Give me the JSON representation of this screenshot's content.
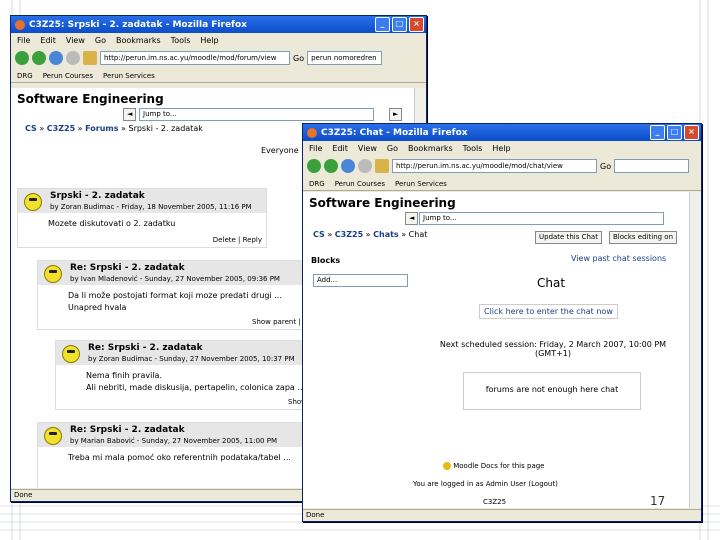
{
  "back_window": {
    "title": "C3Z25: Srpski - 2. zadatak - Mozilla Firefox",
    "menu": [
      "File",
      "Edit",
      "View",
      "Go",
      "Bookmarks",
      "Tools",
      "Help"
    ],
    "url": "http://perun.im.ns.ac.yu/moodle/mod/forum/view",
    "go_label": "Go",
    "search_placeholder": "perun nomoredren",
    "bookmarks": [
      "DRG",
      "Perun Courses",
      "Perun Services"
    ],
    "site_title": "Software Engineering",
    "jump_label": "Jump to...",
    "breadcrumb": {
      "c1": "CS",
      "c2": "C3Z25",
      "c3": "Forums",
      "c4": "Srpski - 2. zadatak"
    },
    "everyone_label": "Everyone",
    "posts": [
      {
        "subject": "Srpski - 2. zadatak",
        "by": "by Zoran Budimac - Friday, 18 November 2005, 11:16 PM",
        "body": "Mozete diskutovati o 2. zadatku",
        "footer": "Delete | Reply"
      },
      {
        "subject": "Re: Srpski - 2. zadatak",
        "by": "by Ivan Mladenović - Sunday, 27 November 2005, 09:36 PM",
        "body": "Da li može postojati format koji moze predati drugi ...",
        "body2": "Unapred hvala",
        "footer": "Show parent | Delete"
      },
      {
        "subject": "Re: Srpski - 2. zadatak",
        "by": "by Zoran Budimac - Sunday, 27 November 2005, 10:37 PM",
        "body": "Nema finih pravila.",
        "body2": "Ali nebriti, made diskusija, pertapelin, colonica zapa ...",
        "footer": "Show"
      },
      {
        "subject": "Re: Srpski - 2. zadatak",
        "by": "by Marian Babović - Sunday, 27 November 2005, 11:00 PM",
        "body": "Treba mi mala pomoć oko referentnih podataka/tabel ...",
        "footer": ""
      }
    ],
    "status": "Done"
  },
  "front_window": {
    "title": "C3Z25: Chat - Mozilla Firefox",
    "menu": [
      "File",
      "Edit",
      "View",
      "Go",
      "Bookmarks",
      "Tools",
      "Help"
    ],
    "url": "http://perun.im.ns.ac.yu/moodle/mod/chat/view",
    "go_label": "Go",
    "bookmarks": [
      "DRG",
      "Perun Courses",
      "Perun Services"
    ],
    "site_title": "Software Engineering",
    "jump_label": "Jump to...",
    "breadcrumb": {
      "c1": "CS",
      "c2": "C3Z25",
      "c3": "Chats",
      "c4": "Chat"
    },
    "update_btn": "Update this Chat",
    "settings_btn": "Blocks editing on",
    "blocks_heading": "Blocks",
    "add_label": "Add...",
    "view_past": "View past chat sessions",
    "chat_title": "Chat",
    "enter_chat": "Click here to enter the chat now",
    "next_session": "Next scheduled session: Friday, 2 March 2007, 10:00 PM",
    "next_session_tz": "(GMT+1)",
    "forums_text": "forums are not enough here chat",
    "moodle_docs": "Moodle Docs for this page",
    "logged_in": "You are logged in as Admin User (Logout)",
    "course_code": "C3Z25",
    "status": "Done"
  },
  "page_number": "17"
}
